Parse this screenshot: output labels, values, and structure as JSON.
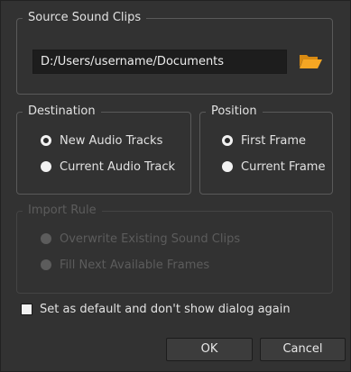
{
  "source": {
    "legend": "Source Sound Clips",
    "path_value": "D:/Users/username/Documents",
    "folder_icon": "folder-open-icon",
    "folder_icon_color": "#f5a623"
  },
  "destination": {
    "legend": "Destination",
    "options": [
      {
        "label": "New Audio Tracks",
        "checked": true
      },
      {
        "label": "Current Audio Track",
        "checked": false
      }
    ]
  },
  "position": {
    "legend": "Position",
    "options": [
      {
        "label": "First Frame",
        "checked": true
      },
      {
        "label": "Current Frame",
        "checked": false
      }
    ]
  },
  "import_rule": {
    "legend": "Import Rule",
    "disabled": true,
    "options": [
      {
        "label": "Overwrite Existing Sound Clips",
        "checked": false
      },
      {
        "label": "Fill Next Available Frames",
        "checked": false
      }
    ]
  },
  "default_checkbox": {
    "label": "Set as default and don't show dialog again",
    "checked": false
  },
  "buttons": {
    "ok": "OK",
    "cancel": "Cancel"
  }
}
